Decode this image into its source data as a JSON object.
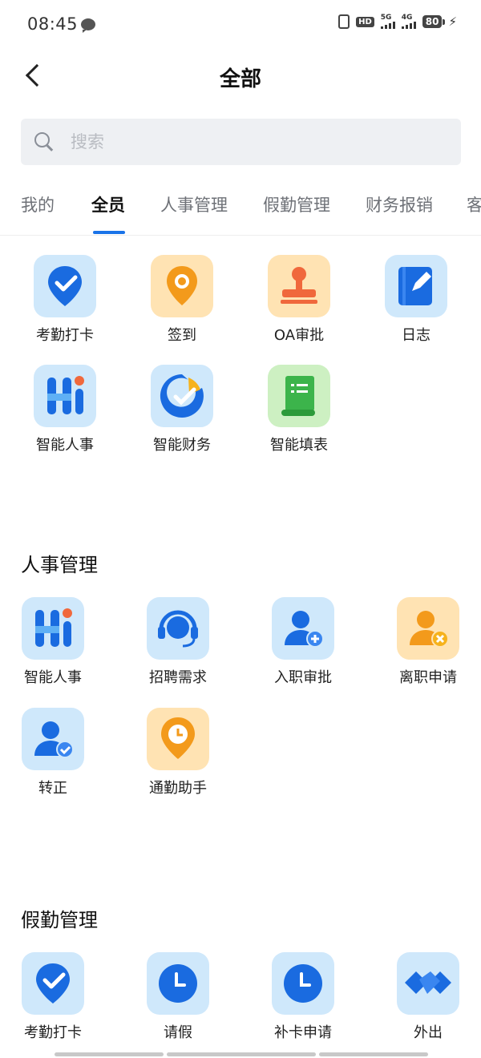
{
  "status_bar": {
    "time": "08:45",
    "hd": "HD",
    "net1": "5G",
    "net2": "4G",
    "battery": "80",
    "bolt": "⚡"
  },
  "header": {
    "title": "全部"
  },
  "search": {
    "placeholder": "搜索"
  },
  "tabs": [
    {
      "label": "我的"
    },
    {
      "label": "全员"
    },
    {
      "label": "人事管理"
    },
    {
      "label": "假勤管理"
    },
    {
      "label": "财务报销"
    },
    {
      "label": "客"
    }
  ],
  "active_tab": "全员",
  "all_items": [
    {
      "label": "考勤打卡",
      "icon": "location-check-icon"
    },
    {
      "label": "签到",
      "icon": "location-pin-icon"
    },
    {
      "label": "OA审批",
      "icon": "stamp-icon"
    },
    {
      "label": "日志",
      "icon": "notebook-pen-icon"
    },
    {
      "label": "智能人事",
      "icon": "hi-logo-icon"
    },
    {
      "label": "智能财务",
      "icon": "finance-logo-icon"
    },
    {
      "label": "智能填表",
      "icon": "form-scroll-icon"
    }
  ],
  "hr_section": {
    "title": "人事管理",
    "items": [
      {
        "label": "智能人事",
        "icon": "hi-logo-icon"
      },
      {
        "label": "招聘需求",
        "icon": "headset-icon"
      },
      {
        "label": "入职审批",
        "icon": "user-add-icon"
      },
      {
        "label": "离职申请",
        "icon": "user-remove-icon"
      },
      {
        "label": "转正",
        "icon": "user-check-icon"
      },
      {
        "label": "通勤助手",
        "icon": "clock-pin-icon"
      }
    ]
  },
  "attendance_section": {
    "title": "假勤管理",
    "items": [
      {
        "label": "考勤打卡",
        "icon": "location-check-icon"
      },
      {
        "label": "请假",
        "icon": "clock-icon"
      },
      {
        "label": "补卡申请",
        "icon": "clock-icon"
      },
      {
        "label": "外出",
        "icon": "handshake-icon"
      }
    ]
  },
  "colors": {
    "accent": "#1a73e8",
    "tile_blue": "#cfe8fb",
    "tile_orange": "#ffe3b3",
    "tile_green": "#cdf0c2"
  }
}
